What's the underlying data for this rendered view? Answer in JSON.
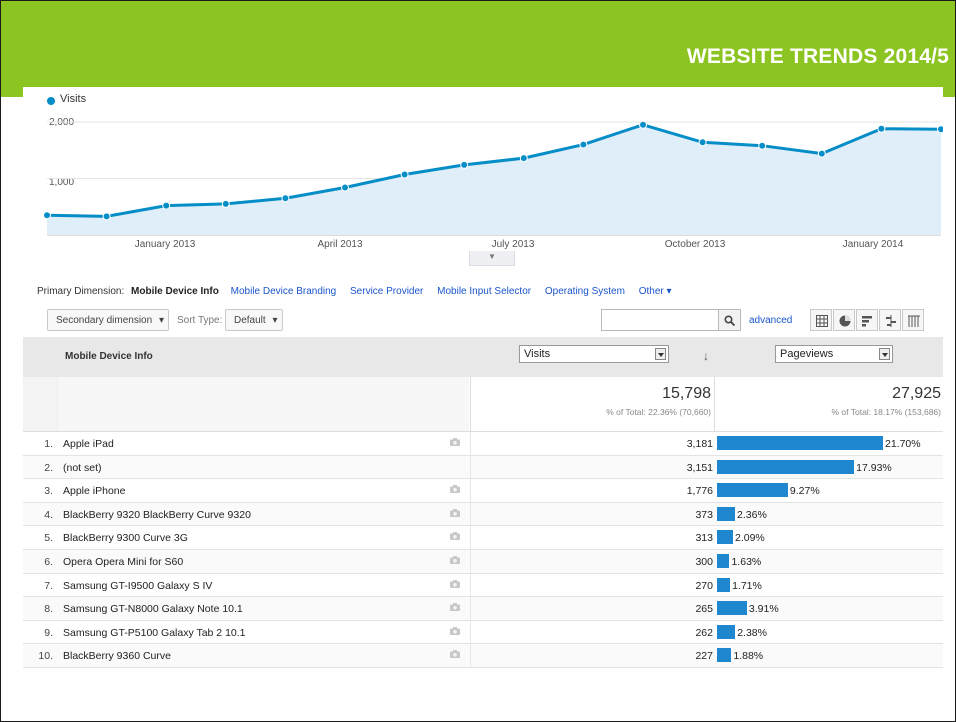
{
  "slide": {
    "title": "WEBSITE TRENDS 2014/5"
  },
  "chart_data": {
    "type": "line",
    "legend": "Visits",
    "y_ticks": [
      "2,000",
      "1,000"
    ],
    "y_tick_values": [
      2000,
      1000
    ],
    "x_ticks": [
      "January 2013",
      "April 2013",
      "July 2013",
      "October 2013",
      "January 2014"
    ],
    "ylim": [
      0,
      2300
    ],
    "series": [
      {
        "name": "Visits",
        "values": [
          350,
          330,
          520,
          550,
          650,
          840,
          1070,
          1240,
          1360,
          1600,
          1950,
          1640,
          1580,
          1440,
          1880,
          1870
        ]
      }
    ],
    "color": "#058dc7",
    "fill": "#dfeef8"
  },
  "dimensions": {
    "label": "Primary Dimension:",
    "current": "Mobile Device Info",
    "links": [
      "Mobile Device Branding",
      "Service Provider",
      "Mobile Input Selector",
      "Operating System"
    ],
    "other": "Other"
  },
  "controls": {
    "secondary": "Secondary dimension",
    "sort_label": "Sort Type:",
    "sort_value": "Default",
    "search_value": "",
    "advanced": "advanced",
    "view_icons": [
      "table-view-icon",
      "pie-view-icon",
      "bar-view-icon",
      "comparison-view-icon",
      "pivot-view-icon"
    ]
  },
  "table": {
    "col_dimension": "Mobile Device Info",
    "metric1": "Visits",
    "metric2": "Pageviews",
    "totals": {
      "visits": "15,798",
      "visits_sub": "% of Total: 22.36% (70,660)",
      "pageviews": "27,925",
      "pageviews_sub": "% of Total: 18.17% (153,686)"
    },
    "rows": [
      {
        "idx": "1.",
        "name": "Apple iPad",
        "visits": "3,181",
        "pct": "21.70%",
        "pct_val": 21.7,
        "cam": true
      },
      {
        "idx": "2.",
        "name": "(not set)",
        "visits": "3,151",
        "pct": "17.93%",
        "pct_val": 17.93,
        "cam": false
      },
      {
        "idx": "3.",
        "name": "Apple iPhone",
        "visits": "1,776",
        "pct": "9.27%",
        "pct_val": 9.27,
        "cam": true
      },
      {
        "idx": "4.",
        "name": "BlackBerry 9320 BlackBerry Curve 9320",
        "visits": "373",
        "pct": "2.36%",
        "pct_val": 2.36,
        "cam": true
      },
      {
        "idx": "5.",
        "name": "BlackBerry 9300 Curve 3G",
        "visits": "313",
        "pct": "2.09%",
        "pct_val": 2.09,
        "cam": true
      },
      {
        "idx": "6.",
        "name": "Opera Opera Mini for S60",
        "visits": "300",
        "pct": "1.63%",
        "pct_val": 1.63,
        "cam": true
      },
      {
        "idx": "7.",
        "name": "Samsung GT-I9500 Galaxy S IV",
        "visits": "270",
        "pct": "1.71%",
        "pct_val": 1.71,
        "cam": true
      },
      {
        "idx": "8.",
        "name": "Samsung GT-N8000 Galaxy Note 10.1",
        "visits": "265",
        "pct": "3.91%",
        "pct_val": 3.91,
        "cam": true
      },
      {
        "idx": "9.",
        "name": "Samsung GT-P5100 Galaxy Tab 2 10.1",
        "visits": "262",
        "pct": "2.38%",
        "pct_val": 2.38,
        "cam": true
      },
      {
        "idx": "10.",
        "name": "BlackBerry 9360 Curve",
        "visits": "227",
        "pct": "1.88%",
        "pct_val": 1.88,
        "cam": true
      }
    ]
  }
}
